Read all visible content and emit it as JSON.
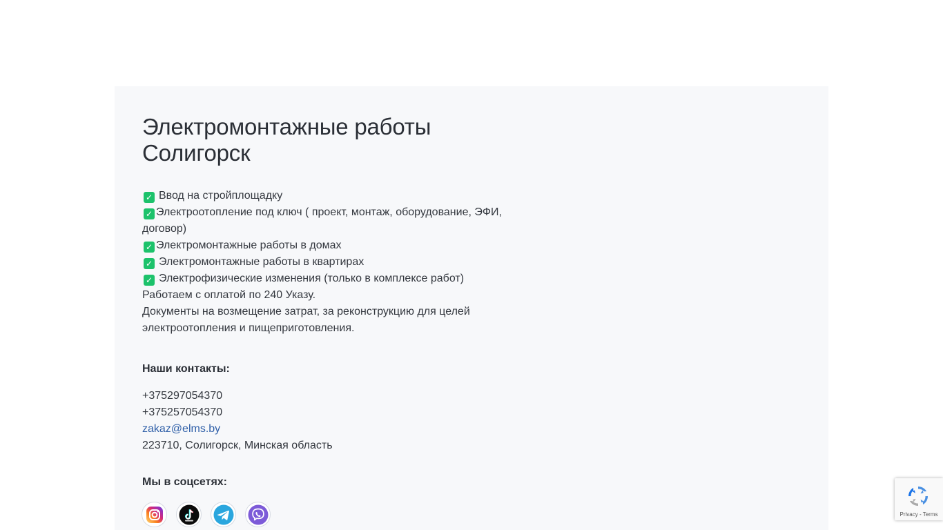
{
  "hero": {
    "title_line1": "Электромонтажные работы",
    "title_line2": "Солигорск"
  },
  "services": [
    "Ввод на стройплощадку",
    "Электроотопление под ключ ( проект, монтаж, оборудование, ЭФИ,",
    "договор)",
    "Электромонтажные работы в домах",
    "Электромонтажные работы в квартирах",
    "Электрофизические изменения (только в комплексе работ)"
  ],
  "notes": [
    "Работаем с оплатой по 240 Указу.",
    "Документы на возмещение затрат, за реконструкцию для целей",
    "электроотопления и пищеприготовления."
  ],
  "contacts": {
    "heading": "Наши контакты:",
    "phone1": "+375297054370",
    "phone2": "+375257054370",
    "email": "zakaz@elms.by",
    "address": "223710, Солигорск, Минская область"
  },
  "socials": {
    "heading": "Мы в соцсетях:",
    "items": [
      "instagram-icon",
      "tiktok-icon",
      "telegram-icon",
      "viber-icon"
    ]
  },
  "recaptcha": {
    "privacy": "Privacy",
    "separator": " - ",
    "terms": "Terms"
  },
  "colors": {
    "check": "#1cc26b",
    "link": "#2f5fa8",
    "panel_bg": "#f7f8fa"
  }
}
